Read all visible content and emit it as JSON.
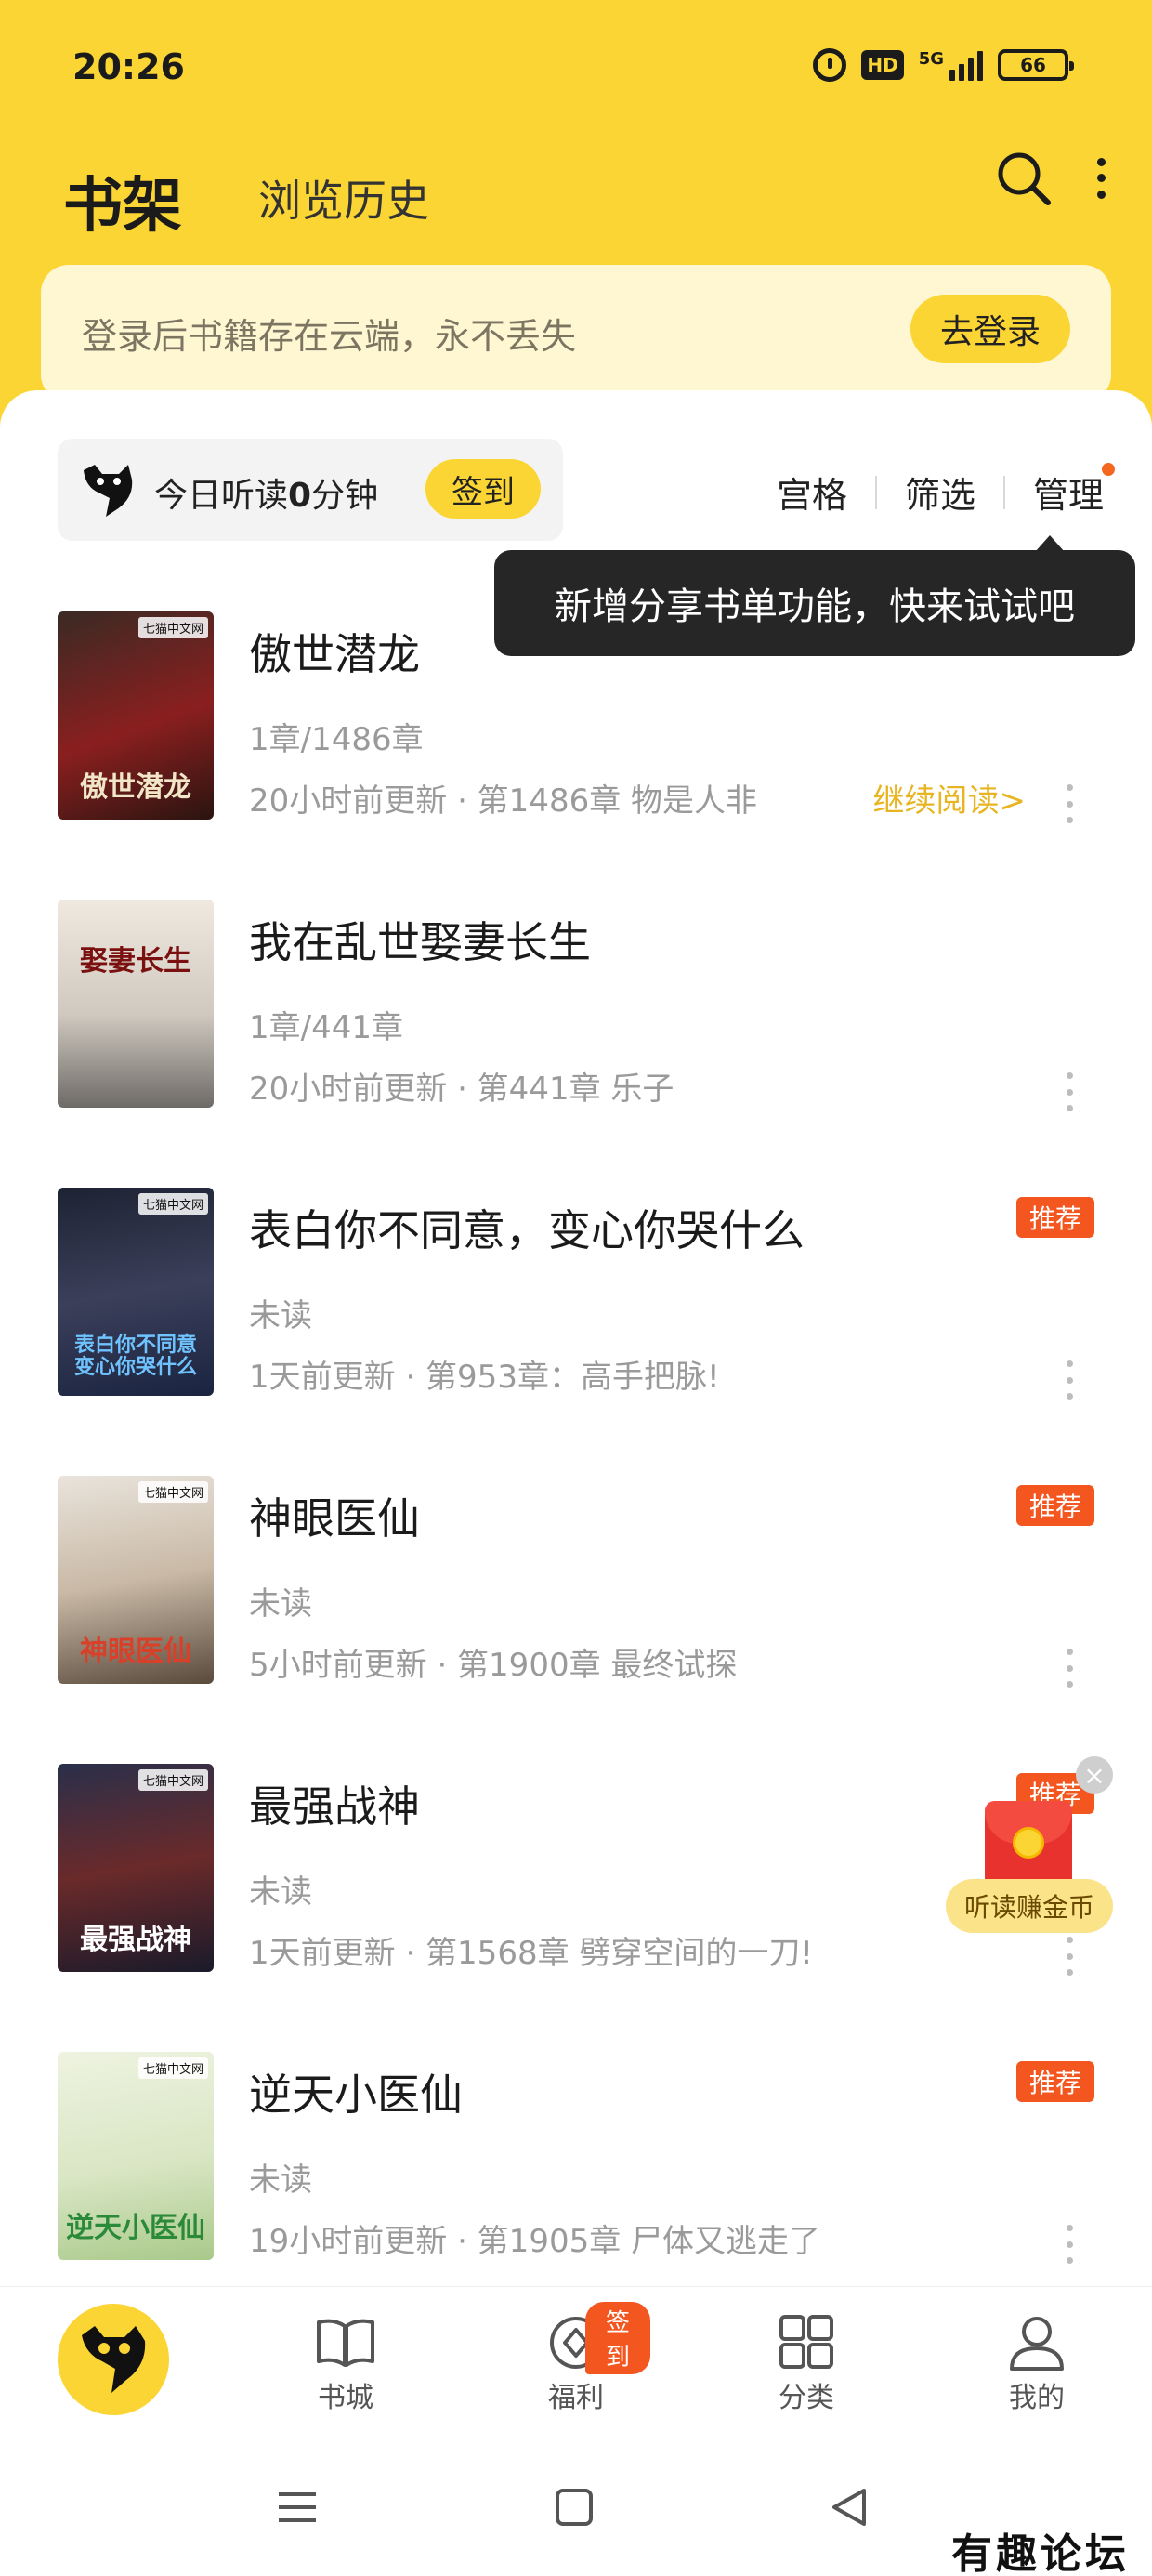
{
  "status_bar": {
    "time": "20:26",
    "hd": "HD",
    "network": "5G",
    "battery": "66"
  },
  "header": {
    "title": "书架",
    "tab_history": "浏览历史"
  },
  "login_banner": {
    "text": "登录后书籍存在云端，永不丢失",
    "button": "去登录"
  },
  "listen": {
    "prefix": "今日听读",
    "minutes": "0",
    "suffix": "分钟",
    "checkin": "签到"
  },
  "toolbar": {
    "grid": "宫格",
    "filter": "筛选",
    "manage": "管理"
  },
  "tooltip": "新增分享书单功能，快来试试吧",
  "books": [
    {
      "title": "傲世潜龙",
      "progress": "1章/1486章",
      "update": "20小时前更新 · 第1486章 物是人非",
      "continue": "继续阅读>",
      "cover_text": "傲世潜龙",
      "cover_brand": "七猫中文网"
    },
    {
      "title": "我在乱世娶妻长生",
      "progress": "1章/441章",
      "update": "20小时前更新 · 第441章 乐子",
      "cover_text": "娶妻长生",
      "cover_brand": ""
    },
    {
      "title": "表白你不同意，变心你哭什么",
      "progress": "未读",
      "update": "1天前更新 · 第953章：高手把脉!",
      "recommend": "推荐",
      "cover_text": "表白你不同意 变心你哭什么",
      "cover_brand": "七猫中文网"
    },
    {
      "title": "神眼医仙",
      "progress": "未读",
      "update": "5小时前更新 · 第1900章 最终试探",
      "recommend": "推荐",
      "cover_text": "神眼医仙",
      "cover_brand": "七猫中文网"
    },
    {
      "title": "最强战神",
      "progress": "未读",
      "update": "1天前更新 · 第1568章 劈穿空间的一刀!",
      "recommend": "推荐",
      "cover_text": "最强战神",
      "cover_brand": "七猫中文网"
    },
    {
      "title": "逆天小医仙",
      "progress": "未读",
      "update": "19小时前更新 · 第1905章 尸体又逃走了",
      "recommend": "推荐",
      "cover_text": "逆天小医仙",
      "cover_brand": "七猫中文网"
    }
  ],
  "floating_reward": {
    "label": "听读赚金币",
    "close": "×"
  },
  "bottom_nav": {
    "bookstore": "书城",
    "welfare": "福利",
    "welfare_badge": "签到",
    "category": "分类",
    "mine": "我的"
  },
  "watermark": "有趣论坛",
  "colors": {
    "brand_yellow": "#fbd533",
    "recommend_red": "#f4561f",
    "continue_gold": "#e8b421"
  }
}
